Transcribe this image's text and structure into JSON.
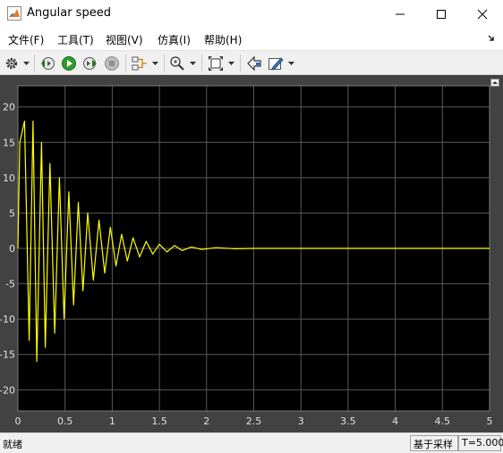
{
  "window": {
    "title": "Angular speed",
    "icon": "matlab-logo-icon"
  },
  "menu": {
    "file": "文件(F)",
    "tools": "工具(T)",
    "view": "视图(V)",
    "simulation": "仿真(I)",
    "help": "帮助(H)"
  },
  "toolbar": {
    "icons": [
      "gear-icon",
      "step-back-icon",
      "run-icon",
      "step-forward-icon",
      "stop-icon",
      "signal-select-icon",
      "zoom-icon",
      "autoscale-icon",
      "highlight-icon",
      "edit-icon"
    ]
  },
  "status": {
    "left": "就绪",
    "sample_mode": "基于采样",
    "time": "T=5.000"
  },
  "colors": {
    "plot_background": "#000000",
    "figure_background": "#424242",
    "trace": "#ffff00",
    "grid": "#5a5a5a",
    "tick_label": "#e0e0e0"
  },
  "chart_data": {
    "type": "line",
    "title": "",
    "xlabel": "",
    "ylabel": "",
    "xlim": [
      0,
      5
    ],
    "ylim": [
      -23,
      23
    ],
    "xticks": [
      0,
      0.5,
      1,
      1.5,
      2,
      2.5,
      3,
      3.5,
      4,
      4.5,
      5
    ],
    "xtick_labels": [
      "0",
      "0.5",
      "1",
      "1.5",
      "2",
      "2.5",
      "3",
      "3.5",
      "4",
      "4.5",
      "5"
    ],
    "yticks": [
      20,
      15,
      10,
      5,
      0,
      -5,
      -10,
      -15,
      -20
    ],
    "ytick_labels": [
      "20",
      "15",
      "10",
      "5",
      "0",
      "-5",
      "-10",
      "-15",
      "-20"
    ],
    "grid": true,
    "legend": "none",
    "series": [
      {
        "peaks": [
          {
            "t": 0.02,
            "y": 15
          },
          {
            "t": 0.07,
            "y": 18
          },
          {
            "t": 0.12,
            "y": -13
          },
          {
            "t": 0.16,
            "y": 18
          },
          {
            "t": 0.2,
            "y": -16
          },
          {
            "t": 0.25,
            "y": 15
          },
          {
            "t": 0.29,
            "y": -14
          },
          {
            "t": 0.34,
            "y": 12
          },
          {
            "t": 0.39,
            "y": -12
          },
          {
            "t": 0.44,
            "y": 10
          },
          {
            "t": 0.49,
            "y": -10
          },
          {
            "t": 0.54,
            "y": 8
          },
          {
            "t": 0.59,
            "y": -8
          },
          {
            "t": 0.64,
            "y": 6.5
          },
          {
            "t": 0.69,
            "y": -6
          },
          {
            "t": 0.74,
            "y": 5
          },
          {
            "t": 0.8,
            "y": -4.5
          },
          {
            "t": 0.86,
            "y": 4
          },
          {
            "t": 0.92,
            "y": -3.5
          },
          {
            "t": 0.98,
            "y": 3
          },
          {
            "t": 1.04,
            "y": -2.5
          },
          {
            "t": 1.1,
            "y": 2
          },
          {
            "t": 1.16,
            "y": -1.8
          },
          {
            "t": 1.22,
            "y": 1.5
          },
          {
            "t": 1.29,
            "y": -1.2
          },
          {
            "t": 1.36,
            "y": 1.0
          },
          {
            "t": 1.43,
            "y": -0.8
          },
          {
            "t": 1.5,
            "y": 0.6
          },
          {
            "t": 1.58,
            "y": -0.5
          },
          {
            "t": 1.66,
            "y": 0.4
          },
          {
            "t": 1.74,
            "y": -0.3
          },
          {
            "t": 1.84,
            "y": 0.2
          },
          {
            "t": 1.95,
            "y": -0.15
          },
          {
            "t": 2.1,
            "y": 0.1
          },
          {
            "t": 2.3,
            "y": -0.05
          },
          {
            "t": 2.5,
            "y": 0
          },
          {
            "t": 5.0,
            "y": 0
          }
        ]
      }
    ]
  }
}
